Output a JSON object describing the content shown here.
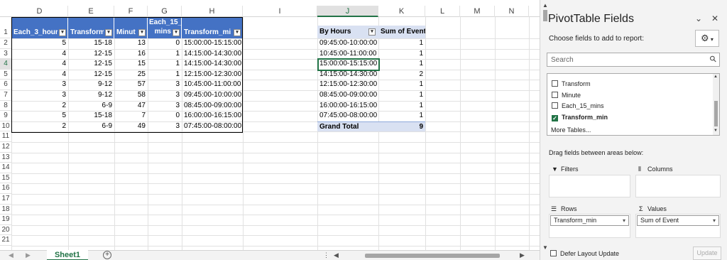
{
  "sheet": {
    "columns": [
      "D",
      "E",
      "F",
      "G",
      "H",
      "I",
      "J",
      "K",
      "L",
      "M",
      "N"
    ],
    "selected_column": "J",
    "rows": [
      "1",
      "2",
      "3",
      "4",
      "5",
      "6",
      "7",
      "8",
      "9",
      "10",
      "11",
      "12",
      "13",
      "14",
      "15",
      "16",
      "17",
      "18",
      "19",
      "20",
      "21"
    ],
    "selected_row": "4",
    "table_headers": {
      "d": "Each_3_hour",
      "e": "Transform",
      "f": "Minut",
      "g_line1": "Each_15_",
      "g_line2": "mins",
      "h": "Transform_mi"
    },
    "table_rows": [
      {
        "d": "5",
        "e": "15-18",
        "f": "13",
        "g": "0",
        "h": "15:00:00-15:15:00"
      },
      {
        "d": "4",
        "e": "12-15",
        "f": "16",
        "g": "1",
        "h": "14:15:00-14:30:00"
      },
      {
        "d": "4",
        "e": "12-15",
        "f": "15",
        "g": "1",
        "h": "14:15:00-14:30:00"
      },
      {
        "d": "4",
        "e": "12-15",
        "f": "25",
        "g": "1",
        "h": "12:15:00-12:30:00"
      },
      {
        "d": "3",
        "e": "9-12",
        "f": "57",
        "g": "3",
        "h": "10:45:00-11:00:00"
      },
      {
        "d": "3",
        "e": "9-12",
        "f": "58",
        "g": "3",
        "h": "09:45:00-10:00:00"
      },
      {
        "d": "2",
        "e": "6-9",
        "f": "47",
        "g": "3",
        "h": "08:45:00-09:00:00"
      },
      {
        "d": "5",
        "e": "15-18",
        "f": "7",
        "g": "0",
        "h": "16:00:00-16:15:00"
      },
      {
        "d": "2",
        "e": "6-9",
        "f": "49",
        "g": "3",
        "h": "07:45:00-08:00:00"
      }
    ],
    "pivot": {
      "row_header": "By Hours",
      "value_header": "Sum of Event",
      "rows": [
        {
          "label": "09:45:00-10:00:00",
          "value": "1"
        },
        {
          "label": "10:45:00-11:00:00",
          "value": "1"
        },
        {
          "label": "15:00:00-15:15:00",
          "value": "1"
        },
        {
          "label": "14:15:00-14:30:00",
          "value": "2"
        },
        {
          "label": "12:15:00-12:30:00",
          "value": "1"
        },
        {
          "label": "08:45:00-09:00:00",
          "value": "1"
        },
        {
          "label": "16:00:00-16:15:00",
          "value": "1"
        },
        {
          "label": "07:45:00-08:00:00",
          "value": "1"
        }
      ],
      "total_label": "Grand Total",
      "total_value": "9"
    },
    "tab_name": "Sheet1",
    "add_sheet": "+"
  },
  "pane": {
    "title": "PivotTable Fields",
    "choose_label": "Choose fields to add to report:",
    "search_placeholder": "Search",
    "fields": [
      {
        "label": "Transform",
        "checked": false
      },
      {
        "label": "Minute",
        "checked": false
      },
      {
        "label": "Each_15_mins",
        "checked": false
      },
      {
        "label": "Transform_min",
        "checked": true
      }
    ],
    "more_tables": "More Tables...",
    "drag_label": "Drag fields between areas below:",
    "areas": {
      "filters": "Filters",
      "columns": "Columns",
      "rows": "Rows",
      "values": "Values"
    },
    "rows_item": "Transform_min",
    "values_item": "Sum of Event",
    "defer_label": "Defer Layout Update",
    "update_label": "Update"
  }
}
